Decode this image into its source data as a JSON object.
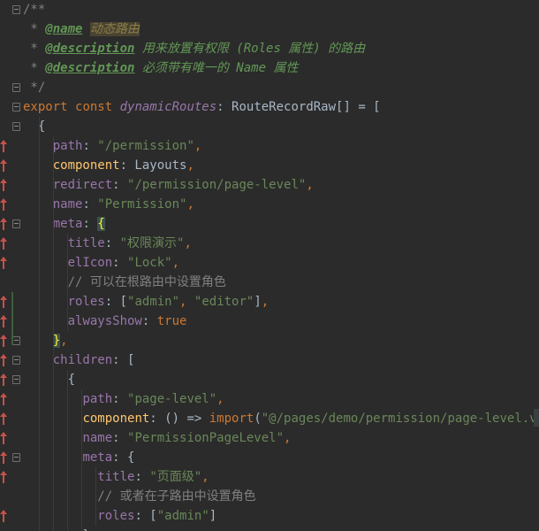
{
  "editor": {
    "lines": [
      {
        "tokens": [
          {
            "t": "/**",
            "c": "c-comment-normal"
          }
        ]
      },
      {
        "tokens": [
          {
            "t": " * ",
            "c": "c-comment-normal"
          },
          {
            "t": "@name",
            "c": "c-tag"
          },
          {
            "t": " ",
            "c": "c-comment"
          },
          {
            "t": "动态路由",
            "c": "c-name-hl"
          }
        ]
      },
      {
        "tokens": [
          {
            "t": " * ",
            "c": "c-comment-normal"
          },
          {
            "t": "@description",
            "c": "c-tag"
          },
          {
            "t": " 用来放置有权限 (Roles 属性) 的路由",
            "c": "c-comment"
          }
        ]
      },
      {
        "tokens": [
          {
            "t": " * ",
            "c": "c-comment-normal"
          },
          {
            "t": "@description",
            "c": "c-tag"
          },
          {
            "t": " 必须带有唯一的 Name 属性",
            "c": "c-comment"
          }
        ]
      },
      {
        "tokens": [
          {
            "t": " */",
            "c": "c-comment-normal"
          }
        ]
      },
      {
        "tokens": [
          {
            "t": "export ",
            "c": "c-keyword"
          },
          {
            "t": "const ",
            "c": "c-keyword"
          },
          {
            "t": "dynamicRoutes",
            "c": "c-ident"
          },
          {
            "t": ": RouteRecordRaw[] = [",
            "c": "c-plain"
          }
        ]
      },
      {
        "tokens": [
          {
            "t": "  {",
            "c": "c-plain"
          }
        ]
      },
      {
        "tokens": [
          {
            "t": "    ",
            "c": "c-plain"
          },
          {
            "t": "path",
            "c": "c-prop"
          },
          {
            "t": ": ",
            "c": "c-plain"
          },
          {
            "t": "\"/permission\"",
            "c": "c-string"
          },
          {
            "t": ",",
            "c": "c-punct"
          }
        ]
      },
      {
        "tokens": [
          {
            "t": "    ",
            "c": "c-plain"
          },
          {
            "t": "component",
            "c": "c-prop2"
          },
          {
            "t": ": Layouts",
            "c": "c-plain"
          },
          {
            "t": ",",
            "c": "c-punct"
          }
        ]
      },
      {
        "tokens": [
          {
            "t": "    ",
            "c": "c-plain"
          },
          {
            "t": "redirect",
            "c": "c-prop"
          },
          {
            "t": ": ",
            "c": "c-plain"
          },
          {
            "t": "\"/permission/page-level\"",
            "c": "c-string"
          },
          {
            "t": ",",
            "c": "c-punct"
          }
        ]
      },
      {
        "tokens": [
          {
            "t": "    ",
            "c": "c-plain"
          },
          {
            "t": "name",
            "c": "c-prop"
          },
          {
            "t": ": ",
            "c": "c-plain"
          },
          {
            "t": "\"Permission\"",
            "c": "c-string"
          },
          {
            "t": ",",
            "c": "c-punct"
          }
        ]
      },
      {
        "tokens": [
          {
            "t": "    ",
            "c": "c-plain"
          },
          {
            "t": "meta",
            "c": "c-prop"
          },
          {
            "t": ": ",
            "c": "c-plain"
          },
          {
            "t": "{",
            "c": "c-brace-hl"
          }
        ]
      },
      {
        "tokens": [
          {
            "t": "      ",
            "c": "c-plain"
          },
          {
            "t": "title",
            "c": "c-prop"
          },
          {
            "t": ": ",
            "c": "c-plain"
          },
          {
            "t": "\"权限演示\"",
            "c": "c-string"
          },
          {
            "t": ",",
            "c": "c-punct"
          }
        ]
      },
      {
        "tokens": [
          {
            "t": "      ",
            "c": "c-plain"
          },
          {
            "t": "elIcon",
            "c": "c-prop"
          },
          {
            "t": ": ",
            "c": "c-plain"
          },
          {
            "t": "\"Lock\"",
            "c": "c-string"
          },
          {
            "t": ",",
            "c": "c-punct"
          }
        ]
      },
      {
        "tokens": [
          {
            "t": "      ",
            "c": "c-plain"
          },
          {
            "t": "// 可以在根路由中设置角色",
            "c": "c-comment-gray"
          }
        ]
      },
      {
        "tokens": [
          {
            "t": "      ",
            "c": "c-plain"
          },
          {
            "t": "roles",
            "c": "c-prop"
          },
          {
            "t": ": [",
            "c": "c-plain"
          },
          {
            "t": "\"admin\"",
            "c": "c-string"
          },
          {
            "t": ", ",
            "c": "c-punct"
          },
          {
            "t": "\"editor\"",
            "c": "c-string"
          },
          {
            "t": "]",
            "c": "c-plain"
          },
          {
            "t": ",",
            "c": "c-punct"
          }
        ]
      },
      {
        "tokens": [
          {
            "t": "      ",
            "c": "c-plain"
          },
          {
            "t": "alwaysShow",
            "c": "c-prop"
          },
          {
            "t": ": ",
            "c": "c-plain"
          },
          {
            "t": "true",
            "c": "c-bool"
          }
        ]
      },
      {
        "tokens": [
          {
            "t": "    ",
            "c": "c-plain"
          },
          {
            "t": "}",
            "c": "c-brace-hl"
          },
          {
            "t": ",",
            "c": "c-punct"
          }
        ]
      },
      {
        "tokens": [
          {
            "t": "    ",
            "c": "c-plain"
          },
          {
            "t": "children",
            "c": "c-prop"
          },
          {
            "t": ": [",
            "c": "c-plain"
          }
        ]
      },
      {
        "tokens": [
          {
            "t": "      {",
            "c": "c-plain"
          }
        ]
      },
      {
        "tokens": [
          {
            "t": "        ",
            "c": "c-plain"
          },
          {
            "t": "path",
            "c": "c-prop"
          },
          {
            "t": ": ",
            "c": "c-plain"
          },
          {
            "t": "\"page-level\"",
            "c": "c-string"
          },
          {
            "t": ",",
            "c": "c-punct"
          }
        ]
      },
      {
        "tokens": [
          {
            "t": "        ",
            "c": "c-plain"
          },
          {
            "t": "component",
            "c": "c-prop2"
          },
          {
            "t": ": () => ",
            "c": "c-plain"
          },
          {
            "t": "import",
            "c": "c-keyword"
          },
          {
            "t": "(",
            "c": "c-plain"
          },
          {
            "t": "\"@/pages/demo/permission/page-level.vue\"",
            "c": "c-string"
          },
          {
            "t": ")",
            "c": "c-brace-hl"
          }
        ]
      },
      {
        "tokens": [
          {
            "t": "        ",
            "c": "c-plain"
          },
          {
            "t": "name",
            "c": "c-prop"
          },
          {
            "t": ": ",
            "c": "c-plain"
          },
          {
            "t": "\"PermissionPageLevel\"",
            "c": "c-string"
          },
          {
            "t": ",",
            "c": "c-punct"
          }
        ]
      },
      {
        "tokens": [
          {
            "t": "        ",
            "c": "c-plain"
          },
          {
            "t": "meta",
            "c": "c-prop"
          },
          {
            "t": ": {",
            "c": "c-plain"
          }
        ]
      },
      {
        "tokens": [
          {
            "t": "          ",
            "c": "c-plain"
          },
          {
            "t": "title",
            "c": "c-prop"
          },
          {
            "t": ": ",
            "c": "c-plain"
          },
          {
            "t": "\"页面级\"",
            "c": "c-string"
          },
          {
            "t": ",",
            "c": "c-punct"
          }
        ]
      },
      {
        "tokens": [
          {
            "t": "          ",
            "c": "c-plain"
          },
          {
            "t": "// 或者在子路由中设置角色",
            "c": "c-comment-gray"
          }
        ]
      },
      {
        "tokens": [
          {
            "t": "          ",
            "c": "c-plain"
          },
          {
            "t": "roles",
            "c": "c-prop"
          },
          {
            "t": ": [",
            "c": "c-plain"
          },
          {
            "t": "\"admin\"",
            "c": "c-string"
          },
          {
            "t": "]",
            "c": "c-plain"
          }
        ]
      },
      {
        "tokens": [
          {
            "t": "        },",
            "c": "c-plain"
          }
        ]
      }
    ]
  },
  "gutter": {
    "change_marker_lines": [
      7,
      8,
      9,
      10,
      11,
      12,
      13,
      15,
      16,
      17,
      18,
      19,
      20,
      21,
      22,
      23,
      24,
      26
    ],
    "fold_lines_open": [
      0,
      4,
      5,
      6,
      11,
      17,
      18,
      19,
      23
    ],
    "marker_icon": "vcs-change-arrow-icon",
    "fold_icon": "fold-toggle-icon"
  }
}
